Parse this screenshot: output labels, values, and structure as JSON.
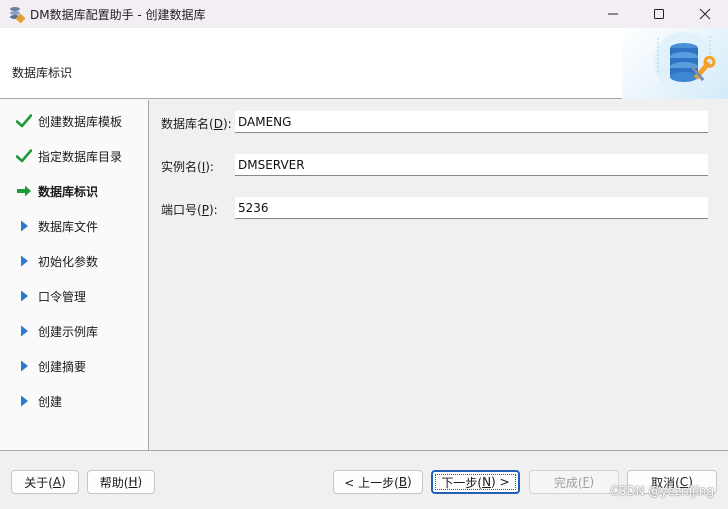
{
  "window": {
    "title": "DM数据库配置助手 - 创建数据库",
    "controls": [
      "minimize-icon",
      "maximize-icon",
      "close-icon"
    ]
  },
  "header": {
    "title": "数据库标识",
    "art_icon": "database-wrench-icon"
  },
  "steps": [
    {
      "label": "创建数据库模板",
      "state": "done",
      "icon": "checkmark-icon"
    },
    {
      "label": "指定数据库目录",
      "state": "done",
      "icon": "checkmark-icon"
    },
    {
      "label": "数据库标识",
      "state": "current",
      "icon": "arrow-right-icon"
    },
    {
      "label": "数据库文件",
      "state": "pending",
      "icon": "triangle-right-icon"
    },
    {
      "label": "初始化参数",
      "state": "pending",
      "icon": "triangle-right-icon"
    },
    {
      "label": "口令管理",
      "state": "pending",
      "icon": "triangle-right-icon"
    },
    {
      "label": "创建示例库",
      "state": "pending",
      "icon": "triangle-right-icon"
    },
    {
      "label": "创建摘要",
      "state": "pending",
      "icon": "triangle-right-icon"
    },
    {
      "label": "创建",
      "state": "pending",
      "icon": "triangle-right-icon"
    }
  ],
  "form": {
    "db_name": {
      "label_pre": "数据库名(",
      "mnemonic": "D",
      "label_post": "):",
      "value": "DAMENG"
    },
    "instance_name": {
      "label_pre": "实例名(",
      "mnemonic": "I",
      "label_post": "):",
      "value": "DMSERVER"
    },
    "port": {
      "label_pre": "端口号(",
      "mnemonic": "P",
      "label_post": "):",
      "value": "5236"
    }
  },
  "buttons": {
    "about": {
      "pre": "关于(",
      "key": "A",
      "post": ")"
    },
    "help": {
      "pre": "帮助(",
      "key": "H",
      "post": ")"
    },
    "back": {
      "pre": "< 上一步(",
      "key": "B",
      "post": ")"
    },
    "next": {
      "pre": "下一步(",
      "key": "N",
      "post": ") >"
    },
    "finish": {
      "pre": "完成(",
      "key": "F",
      "post": ")"
    },
    "cancel": {
      "pre": "取消(",
      "key": "C",
      "post": ")"
    }
  },
  "watermark": "CSDN @yeznijing",
  "colors": {
    "check": "#1f9a3a",
    "arrow_current": "#1f9a3a",
    "arrow_pending": "#2b79d1",
    "primary_border": "#1f5fb6"
  }
}
